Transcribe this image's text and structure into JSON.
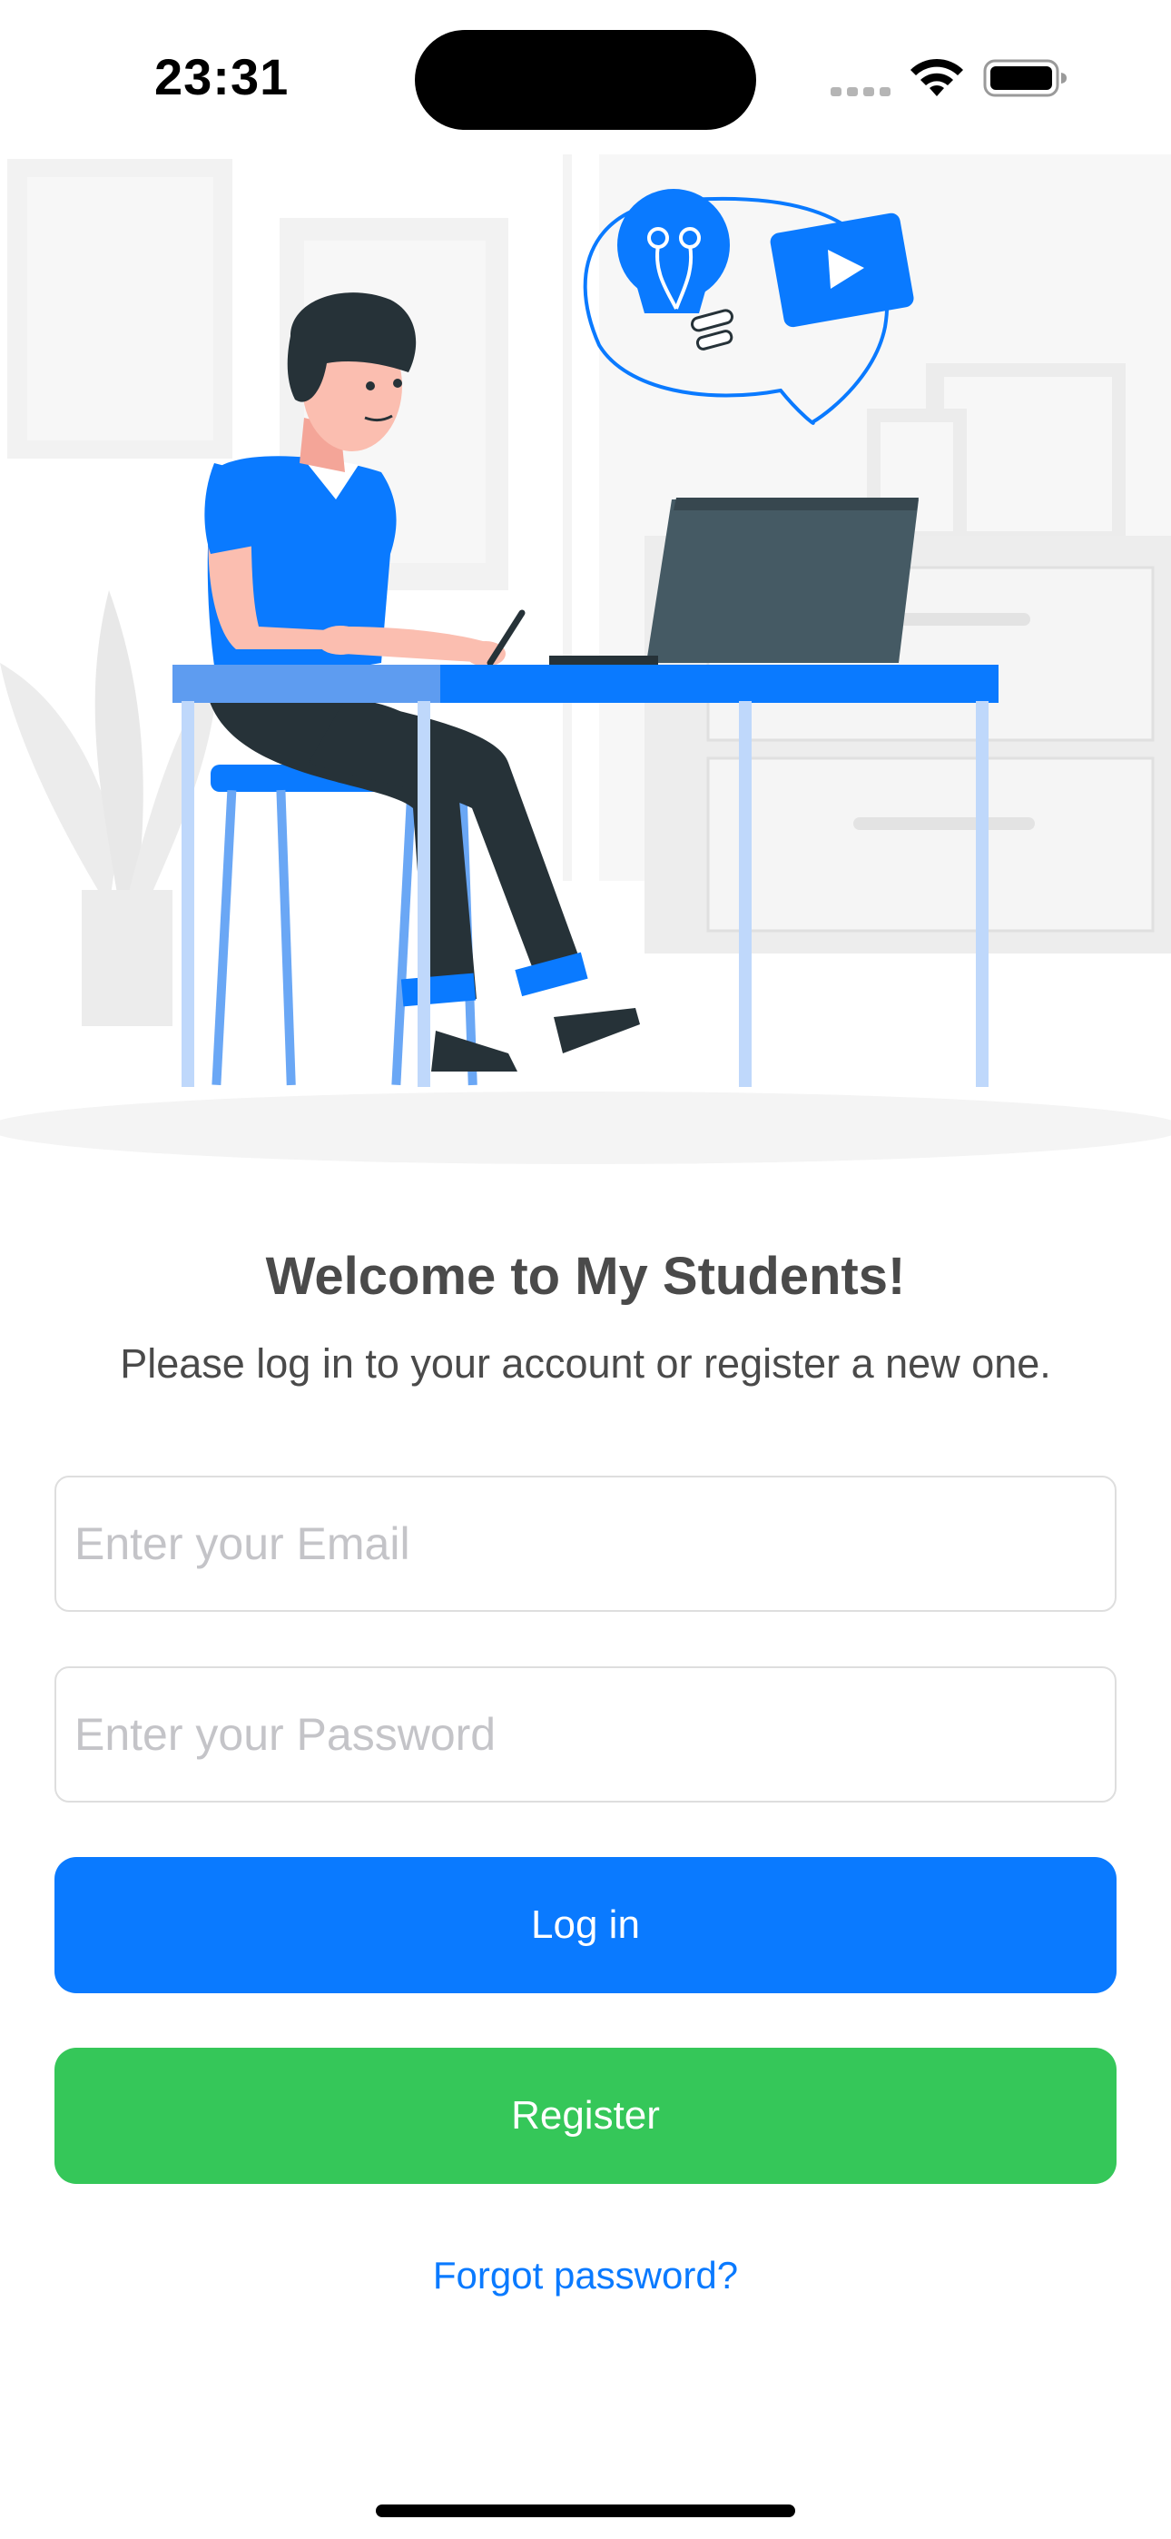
{
  "status_bar": {
    "time": "23:31"
  },
  "colors": {
    "accent_blue": "#0a7aff",
    "register_green": "#35c759",
    "text_gray": "#4a4a4a",
    "placeholder_gray": "#c4c4c8"
  },
  "icons": {
    "signal": "cellular-signal-icon",
    "wifi": "wifi-icon",
    "battery": "battery-icon",
    "lightbulb": "lightbulb-icon",
    "play": "play-icon"
  },
  "welcome": {
    "title": "Welcome to My Students!",
    "subtitle": "Please log in to your account or register a new one."
  },
  "form": {
    "email_placeholder": "Enter your Email",
    "email_value": "",
    "password_placeholder": "Enter your Password",
    "password_value": "",
    "login_label": "Log in",
    "register_label": "Register",
    "forgot_label": "Forgot password?"
  }
}
